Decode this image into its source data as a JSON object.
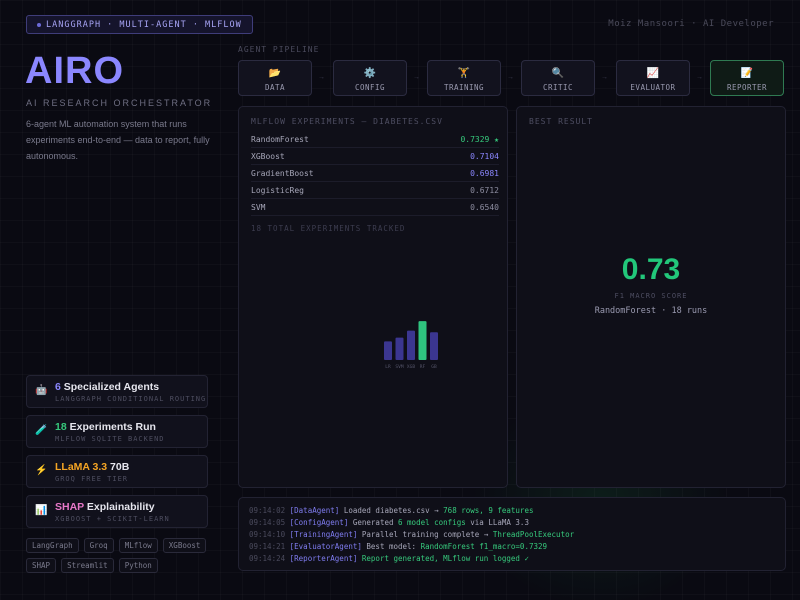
{
  "header": {
    "badge": "LANGGRAPH · MULTI-AGENT · MLFLOW",
    "author": "Moiz Mansoori · AI Developer"
  },
  "brand": {
    "title": "AIRO",
    "subtitle": "AI RESEARCH ORCHESTRATOR",
    "description": "6-agent ML automation system that runs experiments end-to-end — data to report, fully autonomous."
  },
  "stats": [
    {
      "icon": "robot-icon",
      "value": "6",
      "label": "Specialized Agents",
      "sub": "LANGGRAPH CONDITIONAL ROUTING",
      "color": "#8b87ff"
    },
    {
      "icon": "flask-icon",
      "value": "18",
      "label": "Experiments Run",
      "sub": "MLFLOW SQLITE BACKEND",
      "color": "#36c97c"
    },
    {
      "icon": "lightning-icon",
      "value": "LLaMA 3.3",
      "label": "70B",
      "sub": "GROQ FREE TIER",
      "color": "#f5a524"
    },
    {
      "icon": "chart-icon",
      "value": "SHAP",
      "label": "Explainability",
      "sub": "XGBOOST + SCIKIT-LEARN",
      "color": "#e879c9"
    }
  ],
  "tags": [
    "LangGraph",
    "Groq",
    "MLflow",
    "XGBoost",
    "SHAP",
    "Streamlit",
    "Python"
  ],
  "pipeline": {
    "label": "AGENT PIPELINE",
    "steps": [
      {
        "icon": "folder-icon",
        "glyph": "📂",
        "label": "DATA"
      },
      {
        "icon": "gear-icon",
        "glyph": "⚙️",
        "label": "CONFIG"
      },
      {
        "icon": "dumbbell-icon",
        "glyph": "🏋",
        "label": "TRAINING"
      },
      {
        "icon": "magnifier-icon",
        "glyph": "🔍",
        "label": "CRITIC"
      },
      {
        "icon": "line-chart-icon",
        "glyph": "📈",
        "label": "EVALUATOR"
      },
      {
        "icon": "memo-icon",
        "glyph": "📝",
        "label": "REPORTER"
      }
    ],
    "active_step": 5
  },
  "experiments": {
    "title": "MLFLOW EXPERIMENTS — DIABETES.CSV",
    "rows": [
      {
        "name": "RandomForest",
        "value": "0.7329 ★",
        "color": "#36c97c"
      },
      {
        "name": "XGBoost",
        "value": "0.7104",
        "color": "#8b87ff"
      },
      {
        "name": "GradientBoost",
        "value": "0.6981",
        "color": "#8b87ff"
      },
      {
        "name": "LogisticReg",
        "value": "0.6712",
        "color": "#8d8da0"
      },
      {
        "name": "SVM",
        "value": "0.6540",
        "color": "#8d8da0"
      }
    ],
    "total": "18 TOTAL EXPERIMENTS TRACKED"
  },
  "best": {
    "title": "BEST RESULT",
    "score": "0.73",
    "metric": "F1 MACRO SCORE",
    "info": "RandomForest · 18 runs",
    "bars": [
      {
        "label": "LR",
        "value": 0.35
      },
      {
        "label": "SVM",
        "value": 0.42
      },
      {
        "label": "XGB",
        "value": 0.55
      },
      {
        "label": "RF",
        "value": 0.73
      },
      {
        "label": "GB",
        "value": 0.52
      }
    ]
  },
  "logs": [
    {
      "time": "09:14:02",
      "agent": "[DataAgent]",
      "msg": " Loaded diabetes.csv → ",
      "hl": "768 rows, 9 features",
      "rest": ""
    },
    {
      "time": "09:14:05",
      "agent": "[ConfigAgent]",
      "msg": " Generated ",
      "hl": "6 model configs",
      "rest": " via LLaMA 3.3"
    },
    {
      "time": "09:14:10",
      "agent": "[TrainingAgent]",
      "msg": " Parallel training complete → ",
      "hl": "ThreadPoolExecutor",
      "rest": ""
    },
    {
      "time": "09:14:21",
      "agent": "[EvaluatorAgent]",
      "msg": " Best model: ",
      "hl": "RandomForest f1_macro=0.7329",
      "rest": ""
    },
    {
      "time": "09:14:24",
      "agent": "[ReporterAgent]",
      "msg": " ",
      "hl": "Report generated, MLflow run logged ✓",
      "rest": ""
    }
  ]
}
